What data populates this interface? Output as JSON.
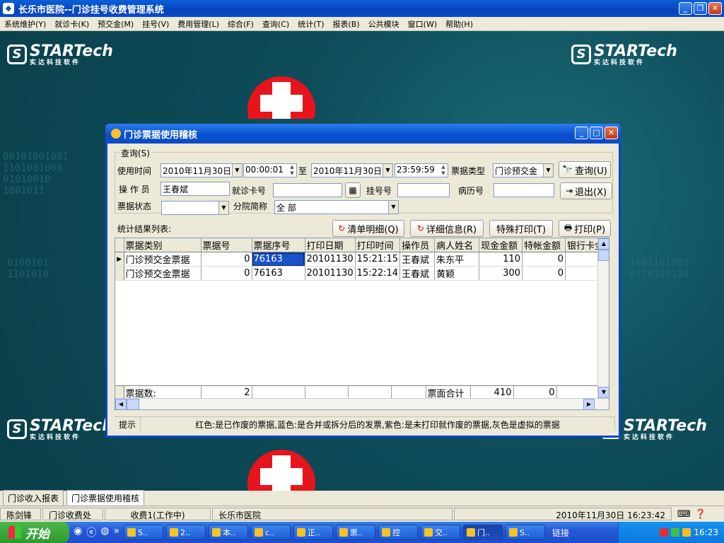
{
  "app": {
    "title": "长乐市医院--门诊挂号收费管理系统"
  },
  "menu": [
    "系统维护(Y)",
    "就诊卡(K)",
    "预交金(M)",
    "挂号(V)",
    "费用管理(L)",
    "综合(F)",
    "查询(C)",
    "统计(T)",
    "报表(B)",
    "公共模块",
    "窗口(W)",
    "帮助(H)"
  ],
  "branding": {
    "logo_text": "STARTech",
    "logo_sub": "实达科技软件"
  },
  "dialog": {
    "title": "门诊票据使用稽核",
    "query_group": "查询(S)",
    "labels": {
      "time": "使用时间",
      "to": "至",
      "ticket_type": "票据类型",
      "operator": "操 作 员",
      "card_no": "就诊卡号",
      "reg_no": "挂号号",
      "record_no": "病历号",
      "ticket_status": "票据状态",
      "branch": "分院简称"
    },
    "fields": {
      "start_date": "2010年11月30日",
      "start_time": "00:00:01",
      "end_date": "2010年11月30日",
      "end_time": "23:59:59",
      "ticket_type": "门诊预交金",
      "operator": "王春斌",
      "card_no": "",
      "reg_no": "",
      "record_no": "",
      "ticket_status": "",
      "branch": "全 部"
    },
    "buttons": {
      "query": "查询(U)",
      "exit": "退出(X)",
      "clear_detail": "清单明细(Q)",
      "detail_info": "详细信息(R)",
      "special_print": "特殊打印(T)",
      "print": "打印(P)"
    },
    "results_label": "统计结果列表:",
    "columns": [
      "票据类别",
      "票据号",
      "票据序号",
      "打印日期",
      "打印时间",
      "操作员",
      "病人姓名",
      "现金金额",
      "特帐金额",
      "银行卡金"
    ],
    "rows": [
      [
        "门诊预交金票据",
        "0",
        "76163",
        "20101130",
        "15:21:15",
        "王春斌",
        "朱东平",
        "110",
        "0",
        ""
      ],
      [
        "门诊预交金票据",
        "0",
        "76163",
        "20101130",
        "15:22:14",
        "王春斌",
        "黄颖",
        "300",
        "0",
        ""
      ]
    ],
    "footer": {
      "count_label": "票据数:",
      "count": "2",
      "sum_label": "票面合计",
      "cash_sum": "410",
      "special_sum": "0"
    },
    "hint_label": "提示",
    "hint_text": "红色:是已作废的票据,蓝色:是合并或拆分后的发票,紫色:是未打印就作废的票据,灰色是虚拟的票据"
  },
  "bottom_tabs": [
    "门诊收入报表",
    "门诊票据使用稽核"
  ],
  "status": {
    "user": "陈剑锋",
    "dept": "门诊收费处",
    "station": "收费1(工作中)",
    "hospital": "长乐市医院",
    "datetime": "2010年11月30日 16:23:42"
  },
  "taskbar": {
    "start": "开始",
    "tasks": [
      "S..",
      "2..",
      "本..",
      "c..",
      "正..",
      "票..",
      "控",
      "交..",
      "门..",
      "S.."
    ],
    "links": "链接",
    "clock": "16:23"
  }
}
